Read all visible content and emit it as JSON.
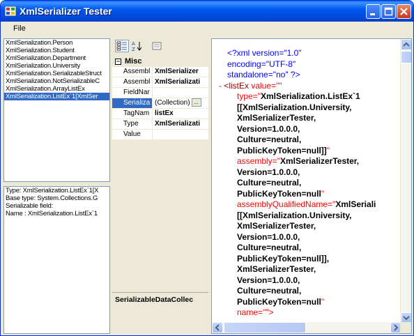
{
  "window": {
    "title": "XmlSerializer Tester"
  },
  "menu": {
    "file": "File"
  },
  "types": [
    "XmlSerialization.Person",
    "XmlSerialization.Student",
    "XmlSerialization.Department",
    "XmlSerialization.University",
    "XmlSerialization.SerializableStruct",
    "XmlSerialization.NotSerializableC",
    "XmlSerialization.ArrayListEx",
    "XmlSerialization.ListEx`1[XmlSer"
  ],
  "selected_type_index": 7,
  "info": [
    "Type: XmlSerialization.ListEx`1[X",
    "Base type: System.Collections.G",
    "Serializable field:",
    "Name : XmlSerialization.ListEx`1"
  ],
  "propgrid": {
    "category": "Misc",
    "rows": [
      {
        "name": "Assembl",
        "value": "XmlSerializer"
      },
      {
        "name": "Assembl",
        "value": "XmlSerializati"
      },
      {
        "name": "FieldNar",
        "value": ""
      },
      {
        "name": "Serializa",
        "value": "(Collection)",
        "button": "..."
      },
      {
        "name": "TagNam",
        "value": "listEx"
      },
      {
        "name": "Type",
        "value": "XmlSerializati"
      },
      {
        "name": "Value",
        "value": ""
      }
    ],
    "description": "SerializableDataCollec"
  },
  "xml": {
    "decl_1": "<?xml version=\"1.0\"",
    "decl_2": "encoding=\"UTF-8\"",
    "decl_3": "standalone=\"no\" ?>",
    "collapse": "-",
    "open_tag": "<listEx",
    "value_attr": "value=\"\"",
    "type_attr": "type=\"",
    "type_val_1": "XmlSerialization.ListEx`1",
    "type_val_2": "[[XmlSerialization.University,",
    "type_val_3": "XmlSerializerTester,",
    "type_val_4": "Version=1.0.0.0,",
    "type_val_5": "Culture=neutral,",
    "type_val_6": "PublicKeyToken=null]]",
    "quote": "\"",
    "assembly_attr": "assembly=\"",
    "assembly_val_1": "XmlSerializerTester,",
    "assembly_val_2": "Version=1.0.0.0,",
    "assembly_val_3": "Culture=neutral,",
    "assembly_val_4": "PublicKeyToken=null",
    "aqn_attr": "assemblyQualifiedName=\"",
    "aqn_val_1": "XmlSeriali",
    "aqn_val_2": "[[XmlSerialization.University,",
    "aqn_val_3": "XmlSerializerTester,",
    "aqn_val_4": "Version=1.0.0.0,",
    "aqn_val_5": "Culture=neutral,",
    "aqn_val_6": "PublicKeyToken=null]],",
    "aqn_val_7": "XmlSerializerTester,",
    "aqn_val_8": "Version=1.0.0.0,",
    "aqn_val_9": "Culture=neutral,",
    "aqn_val_10": "PublicKeyToken=null",
    "name_attr": "name=\"\">"
  }
}
